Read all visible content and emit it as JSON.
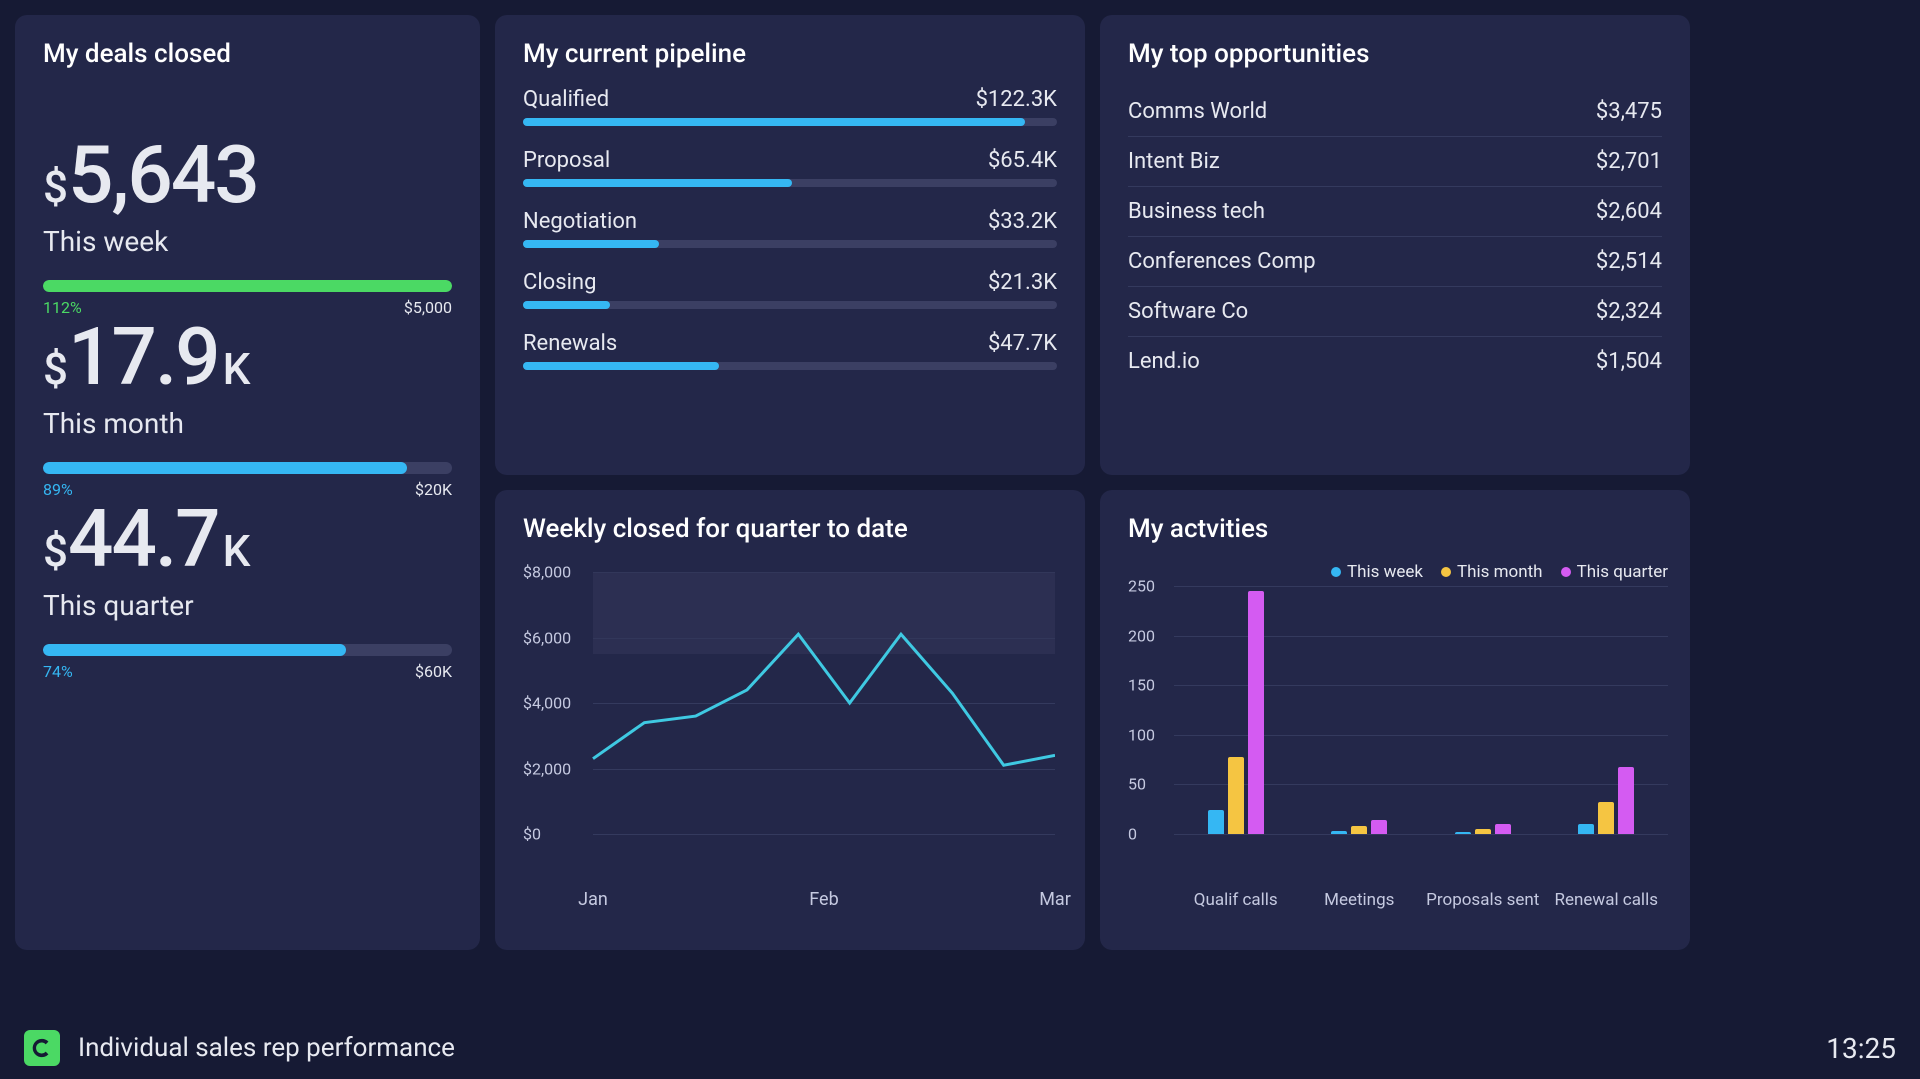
{
  "footer": {
    "label": "Individual sales rep performance",
    "time": "13:25"
  },
  "deals": {
    "title": "My deals closed",
    "blocks": [
      {
        "currency": "$",
        "value": "5,643",
        "suffix": "",
        "period": "This week",
        "pct_label": "112%",
        "target_label": "$5,000",
        "pct": 100,
        "color": "#4bd964",
        "pct_class": "pct-green"
      },
      {
        "currency": "$",
        "value": "17.9",
        "suffix": "K",
        "period": "This month",
        "pct_label": "89%",
        "target_label": "$20K",
        "pct": 89,
        "color": "#35b7f3",
        "pct_class": "pct-blue"
      },
      {
        "currency": "$",
        "value": "44.7",
        "suffix": "K",
        "period": "This quarter",
        "pct_label": "74%",
        "target_label": "$60K",
        "pct": 74,
        "color": "#35b7f3",
        "pct_class": "pct-blue"
      }
    ]
  },
  "pipeline": {
    "title": "My current pipeline",
    "max_value": 130000,
    "items": [
      {
        "label": "Qualified",
        "value_label": "$122.3K",
        "value": 122300
      },
      {
        "label": "Proposal",
        "value_label": "$65.4K",
        "value": 65400
      },
      {
        "label": "Negotiation",
        "value_label": "$33.2K",
        "value": 33200
      },
      {
        "label": "Closing",
        "value_label": "$21.3K",
        "value": 21300
      },
      {
        "label": "Renewals",
        "value_label": "$47.7K",
        "value": 47700
      }
    ]
  },
  "opportunities": {
    "title": "My top opportunities",
    "rows": [
      {
        "name": "Comms World",
        "value": "$3,475"
      },
      {
        "name": "Intent Biz",
        "value": "$2,701"
      },
      {
        "name": "Business tech",
        "value": "$2,604"
      },
      {
        "name": "Conferences Comp",
        "value": "$2,514"
      },
      {
        "name": "Software Co",
        "value": "$2,324"
      },
      {
        "name": "Lend.io",
        "value": "$1,504"
      }
    ]
  },
  "weekly": {
    "title": "Weekly closed for quarter to date",
    "chart_ref": 0
  },
  "activities": {
    "title": "My actvities",
    "legend": [
      "This week",
      "This month",
      "This quarter"
    ],
    "chart_ref": 1
  },
  "chart_data": [
    {
      "type": "line",
      "title": "Weekly closed for quarter to date",
      "xlabel": "",
      "ylabel": "",
      "ylim": [
        0,
        8000
      ],
      "y_ticks": [
        0,
        2000,
        4000,
        6000,
        8000
      ],
      "y_tick_labels": [
        "$0",
        "$2,000",
        "$4,000",
        "$6,000",
        "$8,000"
      ],
      "x_tick_labels": [
        "Jan",
        "Feb",
        "Mar"
      ],
      "goal_band": [
        5500,
        8000
      ],
      "x": [
        0,
        1,
        2,
        3,
        4,
        5,
        6,
        7,
        8,
        9
      ],
      "values": [
        2300,
        3400,
        3600,
        4400,
        6100,
        4000,
        6100,
        4300,
        2100,
        2400
      ],
      "color": "#3fc9e2"
    },
    {
      "type": "bar",
      "title": "My actvities",
      "xlabel": "",
      "ylabel": "",
      "ylim": [
        0,
        250
      ],
      "y_ticks": [
        0,
        50,
        100,
        150,
        200,
        250
      ],
      "categories": [
        "Qualif calls",
        "Meetings",
        "Proposals sent",
        "Renewal calls"
      ],
      "series": [
        {
          "name": "This week",
          "color": "#35b7f3",
          "values": [
            24,
            3,
            2,
            10
          ]
        },
        {
          "name": "This month",
          "color": "#f5c542",
          "values": [
            78,
            8,
            5,
            32
          ]
        },
        {
          "name": "This quarter",
          "color": "#d45bf2",
          "values": [
            245,
            14,
            10,
            68
          ]
        }
      ]
    }
  ]
}
